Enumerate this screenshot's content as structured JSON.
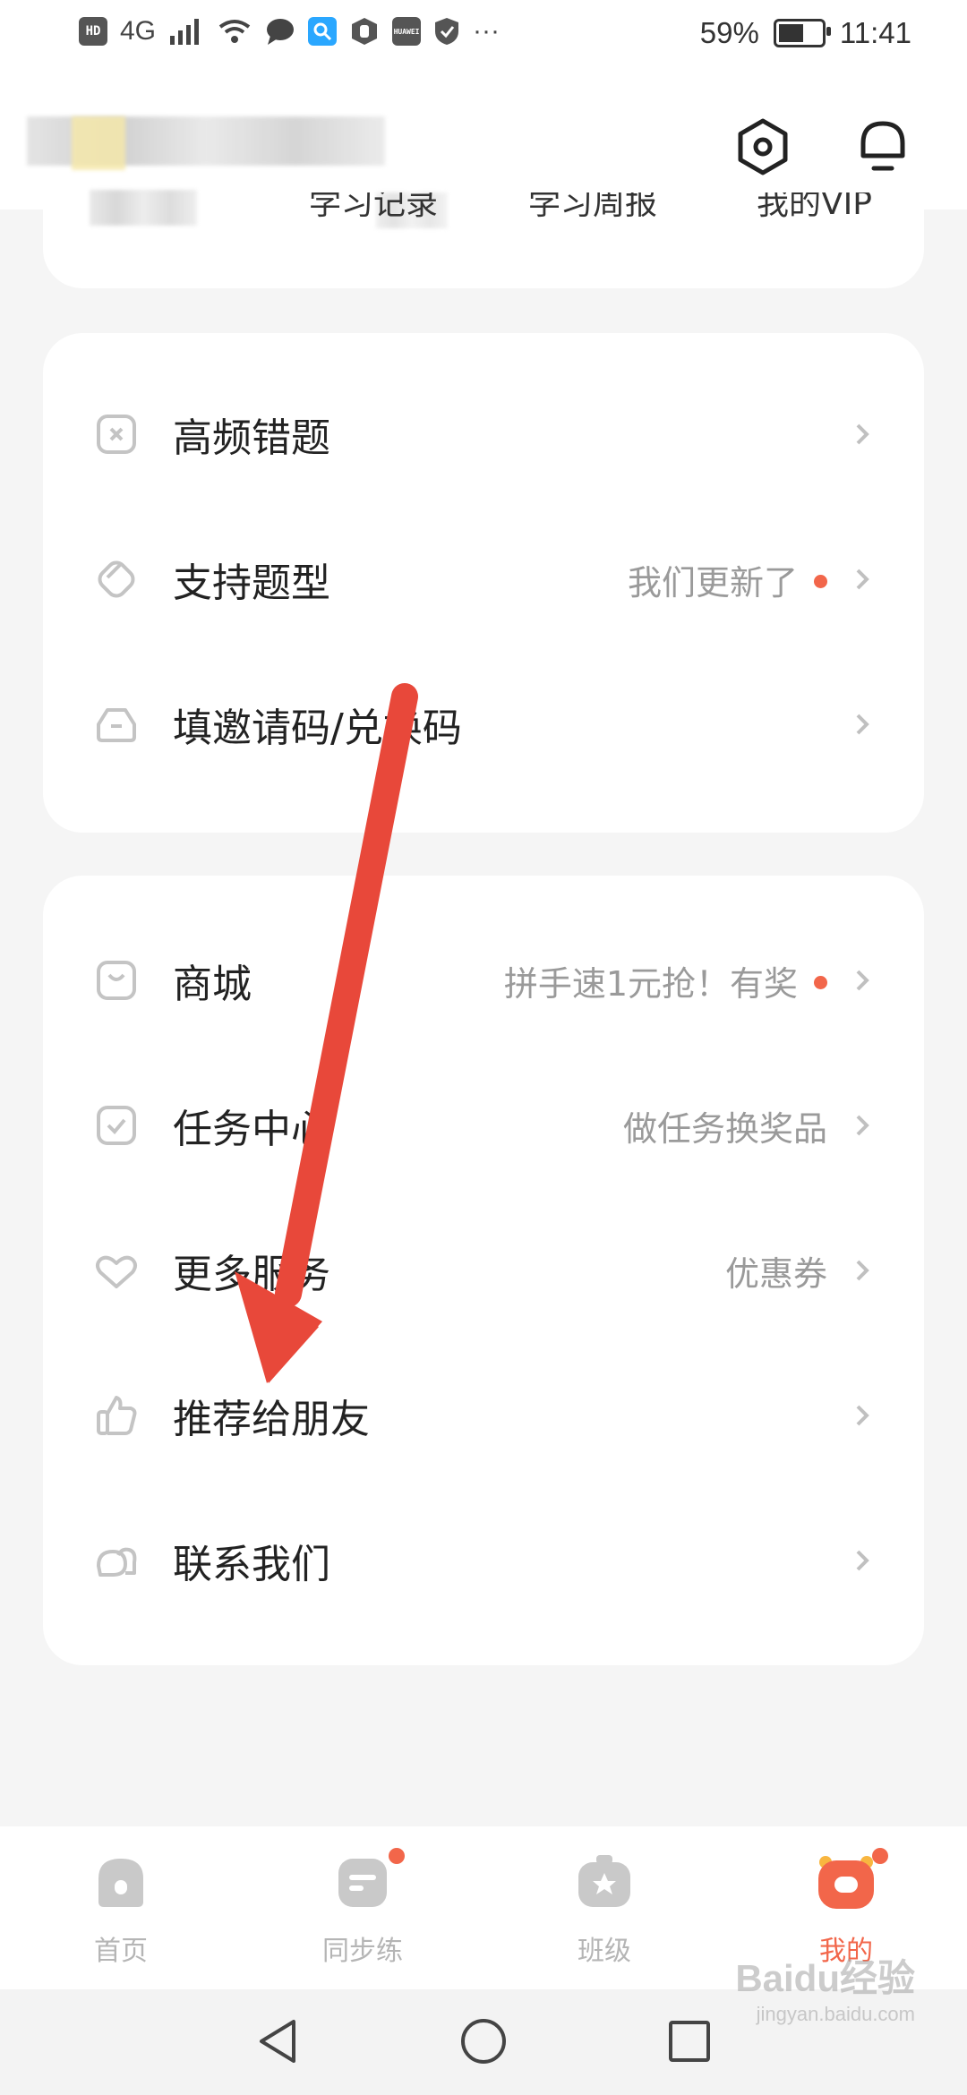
{
  "status_bar": {
    "left_icons": [
      "hd-icon",
      "signal-4g-icon",
      "wifi-icon",
      "chat-bubble-icon",
      "search-app-icon",
      "hand-icon",
      "huawei-icon",
      "shield-icon",
      "more-dots-icon"
    ],
    "hd_label": "HD",
    "network_label": "4G",
    "more": "···",
    "battery": "59%",
    "battery_level": 0.59,
    "time": "11:41"
  },
  "header": {
    "quick_links": [
      "学习记录",
      "学习周报",
      "我的VIP"
    ],
    "icons": [
      "settings-icon",
      "notification-bell-icon"
    ]
  },
  "card1": {
    "items": [
      {
        "label": "高频错题",
        "sub": "",
        "icon": "wrong-question-icon",
        "dot": false
      },
      {
        "label": "支持题型",
        "sub": "我们更新了",
        "icon": "question-type-icon",
        "dot": true
      },
      {
        "label": "填邀请码/兑换码",
        "sub": "",
        "icon": "invite-code-icon",
        "dot": false
      }
    ]
  },
  "card2": {
    "items": [
      {
        "label": "商城",
        "sub": "拼手速1元抢！有奖",
        "icon": "store-icon",
        "dot": true
      },
      {
        "label": "任务中心",
        "sub": "做任务换奖品",
        "icon": "task-center-icon",
        "dot": false
      },
      {
        "label": "更多服务",
        "sub": "优惠券",
        "icon": "more-services-icon",
        "dot": false
      },
      {
        "label": "推荐给朋友",
        "sub": "",
        "icon": "thumbs-up-icon",
        "dot": false
      },
      {
        "label": "联系我们",
        "sub": "",
        "icon": "contact-us-icon",
        "dot": false
      }
    ]
  },
  "tabbar": {
    "tabs": [
      {
        "label": "首页",
        "icon": "home-tab-icon",
        "active": false,
        "dot": false
      },
      {
        "label": "同步练",
        "icon": "practice-tab-icon",
        "active": false,
        "dot": true
      },
      {
        "label": "班级",
        "icon": "class-tab-icon",
        "active": false,
        "dot": false
      },
      {
        "label": "我的",
        "icon": "mine-tab-icon",
        "active": true,
        "dot": true
      }
    ]
  },
  "navbar": {
    "buttons": [
      "back-icon",
      "home-icon",
      "recents-icon"
    ]
  },
  "watermark": {
    "brand": "Baidu经验",
    "url": "jingyan.baidu.com"
  },
  "colors": {
    "accent": "#f2664a",
    "arrow": "#e8483a",
    "muted": "#9a9a9a",
    "background": "#f5f5f5"
  }
}
